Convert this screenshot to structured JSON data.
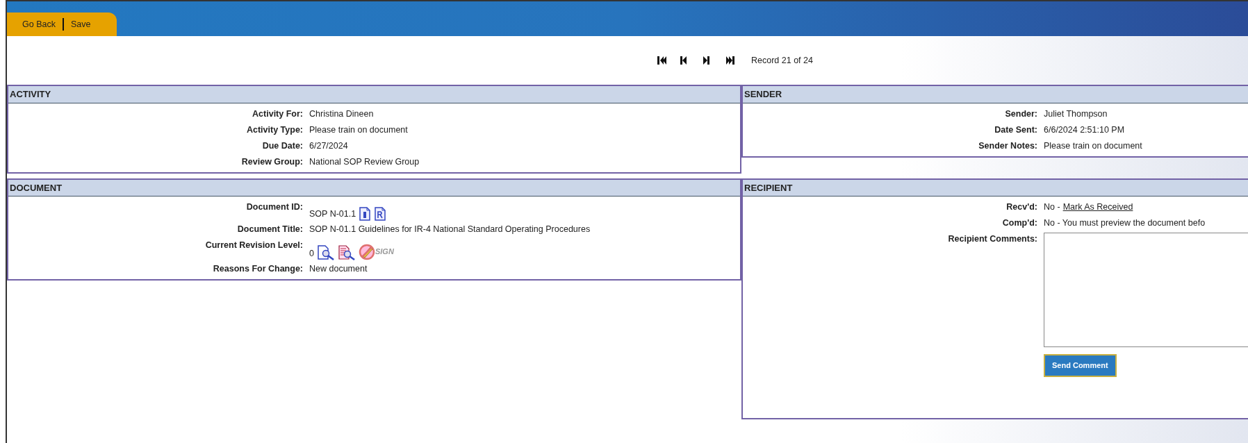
{
  "toolbar": [
    {
      "label": "Go Back"
    },
    {
      "label": "Save"
    }
  ],
  "record_nav": {
    "buttons": [
      {
        "kind": "first"
      },
      {
        "kind": "prev"
      },
      {
        "kind": "next"
      },
      {
        "kind": "last"
      }
    ],
    "text": "Record 21 of 24"
  },
  "panels": [
    {
      "title": "ACTIVITY",
      "fields": [
        {
          "kind": "text",
          "label": "Activity For:",
          "value": "Christina Dineen"
        },
        {
          "kind": "text",
          "label": "Activity Type:",
          "value": "Please train on document"
        },
        {
          "kind": "text",
          "label": "Due Date:",
          "value": "6/27/2024"
        },
        {
          "kind": "text",
          "label": "Review Group:",
          "value": "National SOP Review Group"
        }
      ]
    },
    {
      "title": "SENDER",
      "fields": [
        {
          "kind": "text",
          "label": "Sender:",
          "value": "Juliet Thompson"
        },
        {
          "kind": "text",
          "label": "Date Sent:",
          "value": "6/6/2024 2:51:10 PM"
        },
        {
          "kind": "text",
          "label": "Sender Notes:",
          "value": "Please train on document"
        }
      ]
    },
    {
      "title": "DOCUMENT",
      "fields": [
        {
          "kind": "doc_id",
          "label": "Document ID:",
          "value": "SOP N-01.1"
        },
        {
          "kind": "text",
          "label": "Document Title:",
          "value": "SOP N-01.1 Guidelines for IR-4 National Standard Operating Procedures"
        },
        {
          "kind": "revision",
          "label": "Current Revision Level:",
          "value": "0",
          "sign_label": "SIGN"
        },
        {
          "kind": "text",
          "label": "Reasons For Change:",
          "value": "New document"
        }
      ]
    },
    {
      "title": "RECIPIENT",
      "fields": [
        {
          "kind": "link",
          "label": "Recv'd:",
          "value": "No -",
          "link": "Mark As Received"
        },
        {
          "kind": "text",
          "label": "Comp'd:",
          "value": "No - You must preview the document befo"
        },
        {
          "kind": "textarea",
          "label": "Recipient Comments:",
          "button": "Send Comment"
        }
      ]
    }
  ]
}
